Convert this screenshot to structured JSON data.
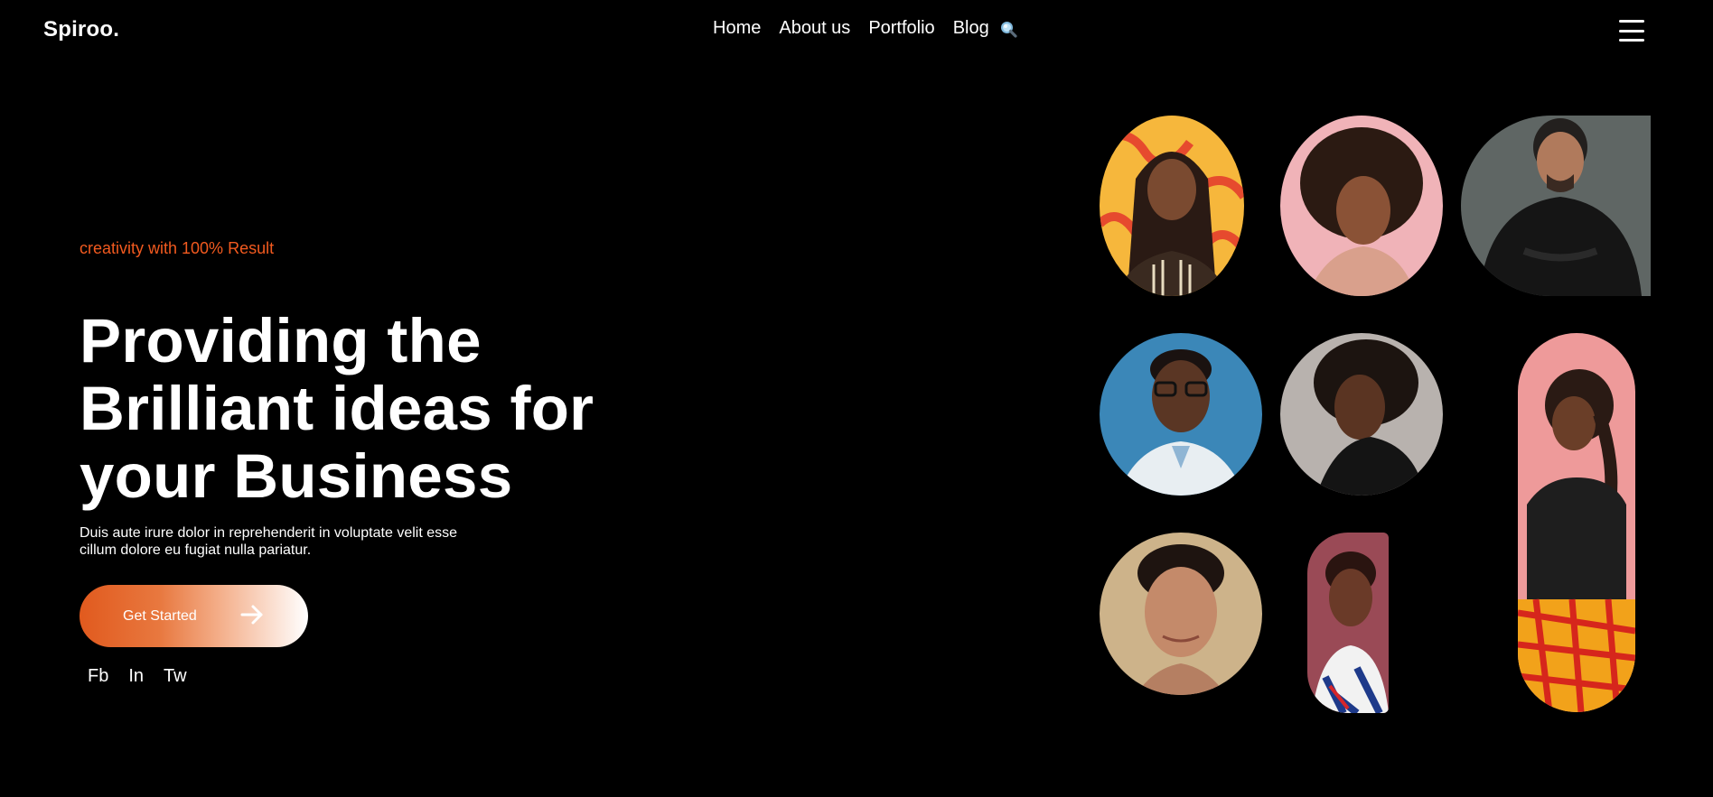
{
  "header": {
    "logo": "Spiroo.",
    "nav": [
      "Home",
      "About us",
      "Portfolio",
      "Blog"
    ]
  },
  "hero": {
    "tagline": "creativity with 100% Result",
    "headline_lines": [
      "Providing the",
      "Brilliant ideas for",
      "your Business"
    ],
    "description_lines": [
      "Duis aute irure dolor in reprehenderit in voluptate velit esse",
      "cillum dolore eu fugiat nulla pariatur."
    ],
    "cta_label": "Get Started"
  },
  "socials": [
    "Fb",
    "In",
    "Tw"
  ],
  "colors": {
    "accent": "#f25a1f",
    "background": "#000000",
    "text": "#ffffff"
  }
}
